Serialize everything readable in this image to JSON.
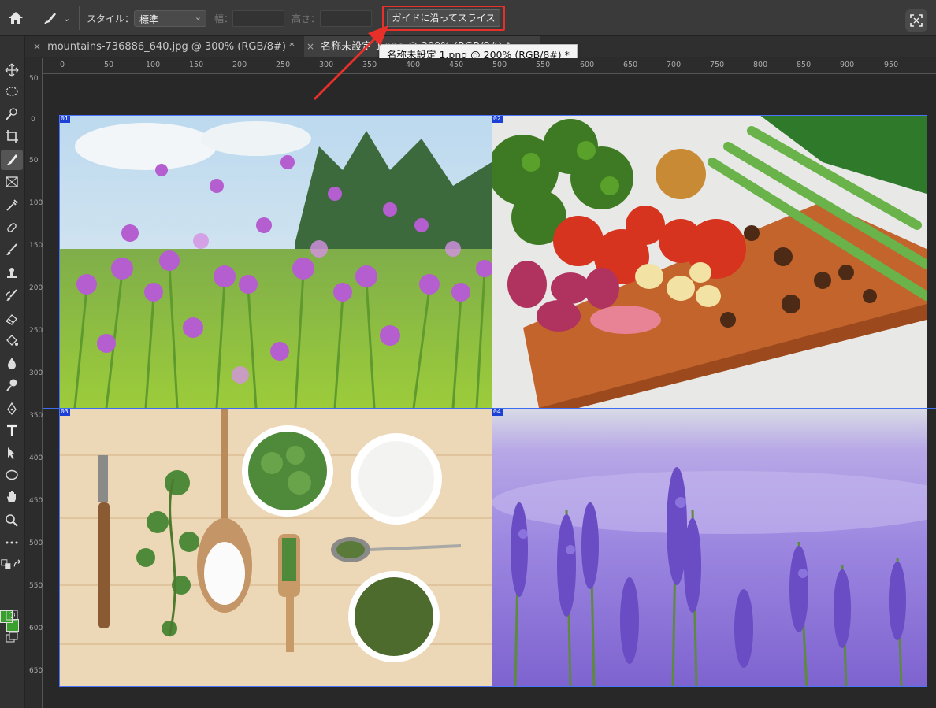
{
  "options_bar": {
    "style_label": "スタイル：",
    "style_value": "標準",
    "width_label": "幅：",
    "height_label": "高さ：",
    "slice_button_label": "ガイドに沿ってスライス"
  },
  "tabs": [
    {
      "label": "mountains-736886_640.jpg @ 300% (RGB/8#) *",
      "close": "×"
    },
    {
      "label": "名称未設定 1.png @ 200% (RGB/8#) *",
      "close": "×"
    }
  ],
  "tooltip": "名称未設定 1.png @ 200% (RGB/8#) *",
  "ruler_top_ticks": [
    "0",
    "50",
    "100",
    "150",
    "200",
    "250",
    "300",
    "350",
    "400",
    "450",
    "500",
    "550",
    "600",
    "650",
    "700",
    "750",
    "800",
    "850",
    "900",
    "950"
  ],
  "ruler_left_ticks": [
    "50",
    "0",
    "50",
    "100",
    "150",
    "200",
    "250",
    "300",
    "350",
    "400",
    "450",
    "500",
    "550",
    "600",
    "650"
  ],
  "slices": [
    "01",
    "02",
    "03",
    "04"
  ],
  "tools": [
    "move-icon",
    "lasso-icon",
    "quick-select-icon",
    "crop-icon",
    "slice-icon",
    "frame-icon",
    "eyedropper-icon",
    "healing-icon",
    "brush-icon",
    "stamp-icon",
    "history-brush-icon",
    "eraser-icon",
    "paint-bucket-icon",
    "blur-icon",
    "dodge-icon",
    "pen-icon",
    "type-icon",
    "path-select-icon",
    "ellipse-icon",
    "hand-icon",
    "zoom-icon",
    "more-icon"
  ],
  "colors": {
    "accent_red": "#e8302a",
    "guide_cyan": "#3fd6e6",
    "slice_blue": "#1c3fd6",
    "foreground": "#3aa02d",
    "background": "#3aa02d"
  }
}
